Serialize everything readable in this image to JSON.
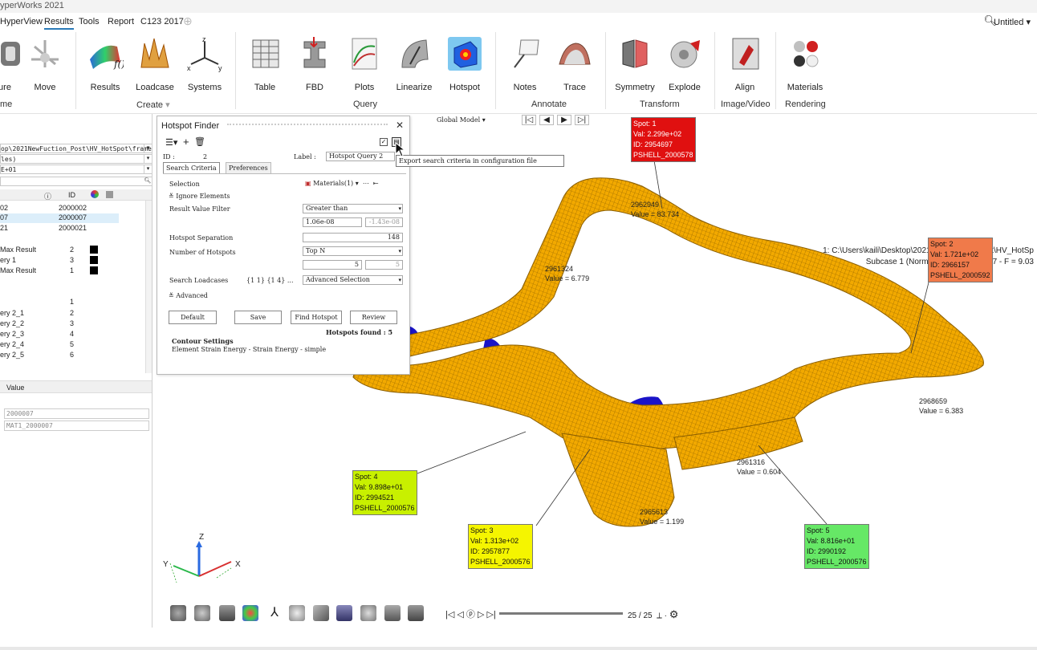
{
  "app": {
    "title": "yperWorks 2021"
  },
  "menubar": {
    "items": [
      "HyperView",
      "Results",
      "Tools",
      "Report",
      "C123 2017"
    ],
    "active": "Results",
    "doc_title": "Untitled"
  },
  "ribbon": {
    "buttons": [
      {
        "label": "ure",
        "icon": "measure-icon"
      },
      {
        "label": "Move",
        "icon": "move-icon"
      },
      {
        "label": "Results",
        "icon": "results-icon"
      },
      {
        "label": "Loadcase",
        "icon": "loadcase-icon"
      },
      {
        "label": "Systems",
        "icon": "systems-icon"
      },
      {
        "label": "Table",
        "icon": "table-icon"
      },
      {
        "label": "FBD",
        "icon": "fbd-icon"
      },
      {
        "label": "Plots",
        "icon": "plots-icon"
      },
      {
        "label": "Linearize",
        "icon": "linearize-icon"
      },
      {
        "label": "Hotspot",
        "icon": "hotspot-icon"
      },
      {
        "label": "Notes",
        "icon": "notes-icon"
      },
      {
        "label": "Trace",
        "icon": "trace-icon"
      },
      {
        "label": "Symmetry",
        "icon": "symmetry-icon"
      },
      {
        "label": "Explode",
        "icon": "explode-icon"
      },
      {
        "label": "Align",
        "icon": "align-icon"
      },
      {
        "label": "Materials",
        "icon": "materials-icon"
      }
    ],
    "groups": [
      "me",
      "Create",
      "Query",
      "Annotate",
      "Transform",
      "Image/Video",
      "Rendering"
    ]
  },
  "left_panel": {
    "path_field": "op\\2021NewFuction_Post\\HV_HotSpot\\frame",
    "field2": "les)",
    "field3": "E+01",
    "col_id": "ID",
    "rows": [
      {
        "name": "02",
        "id": "2000002"
      },
      {
        "name": "07",
        "id": "2000007"
      },
      {
        "name": "21",
        "id": "2000021"
      }
    ],
    "queries": [
      {
        "name": "Max Result",
        "id": "2"
      },
      {
        "name": "ery 1",
        "id": "3"
      },
      {
        "name": "Max Result",
        "id": "1"
      },
      {
        "name": "",
        "id": "1"
      },
      {
        "name": "ery 2_1",
        "id": "2"
      },
      {
        "name": "ery 2_2",
        "id": "3"
      },
      {
        "name": "ery 2_3",
        "id": "4"
      },
      {
        "name": "ery 2_4",
        "id": "5"
      },
      {
        "name": "ery 2_5",
        "id": "6"
      }
    ],
    "value_header": "Value",
    "value1": "2000007",
    "value2": "MAT1_2000007"
  },
  "dialog": {
    "title": "Hotspot Finder",
    "id_label": "ID :",
    "id_value": "2",
    "label_label": "Label :",
    "label_value": "Hotspot Query 2",
    "tab1": "Search Criteria",
    "tab2": "Preferences",
    "selection_label": "Selection",
    "selection_value": "Materials(1)",
    "ignore_label": "Ignore Elements",
    "filter_label": "Result Value Filter",
    "filter_value": "Greater than",
    "filter_min": "1.06e-08",
    "filter_max": "-1.43e-08",
    "separation_label": "Hotspot Separation",
    "separation_value": "148",
    "num_label": "Number of Hotspots",
    "num_value": "Top N",
    "num_n": "5",
    "num_n2": "5",
    "loadcases_label": "Search Loadcases",
    "loadcases_value": "{1 1} {1 4} ...",
    "loadcases_select": "Advanced Selection",
    "advanced_label": "Advanced",
    "btn_default": "Default",
    "btn_save": "Save",
    "btn_find": "Find Hotspot",
    "btn_review": "Review",
    "found": "Hotspots found : 5",
    "contour_title": "Contour Settings",
    "contour_desc": "Element Strain Energy - Strain Energy - simple"
  },
  "tooltip": "Export search criteria in configuration file",
  "viewport": {
    "model_selector": "Global Model",
    "info_line1": "1: C:\\Users\\kaili\\Desktop\\2021NewFuction_Post\\HV_HotSp",
    "info_line2": "Subcase 1 (Normal Modes) : Mode 7 - F = 9.03",
    "spots": [
      {
        "lines": [
          "Spot: 1",
          "Val: 2.299e+02",
          "ID: 2954697",
          "PSHELL_2000578"
        ],
        "color": "#e01010",
        "text": "#ffffff"
      },
      {
        "lines": [
          "Spot: 2",
          "Val: 1.721e+02",
          "ID: 2966157",
          "PSHELL_2000592"
        ],
        "color": "#f07a4a",
        "text": "#111111"
      },
      {
        "lines": [
          "Spot: 3",
          "Val: 1.313e+02",
          "ID: 2957877",
          "PSHELL_2000576"
        ],
        "color": "#f5f500",
        "text": "#111111"
      },
      {
        "lines": [
          "Spot: 4",
          "Val: 9.898e+01",
          "ID: 2994521",
          "PSHELL_2000576"
        ],
        "color": "#c8f000",
        "text": "#111111"
      },
      {
        "lines": [
          "Spot: 5",
          "Val: 8.816e+01",
          "ID: 2990192",
          "PSHELL_2000576"
        ],
        "color": "#66e866",
        "text": "#111111"
      }
    ],
    "nodes": [
      {
        "id": "2962949",
        "value": "Value = 83.734"
      },
      {
        "id": "2961324",
        "value": "Value = 6.779"
      },
      {
        "id": "2968659",
        "value": "Value = 6.383"
      },
      {
        "id": "2961316",
        "value": "Value = 0.604"
      },
      {
        "id": "2965613",
        "value": "Value = 1.199"
      }
    ],
    "triad": {
      "z": "Z",
      "y": "Y",
      "x": "X"
    },
    "frame": "25 / 25"
  },
  "colors": {
    "mesh": "#f2a900",
    "mesh_line": "#8a5e00",
    "blue_part": "#1a14c8",
    "accent": "#2a7ab8"
  }
}
